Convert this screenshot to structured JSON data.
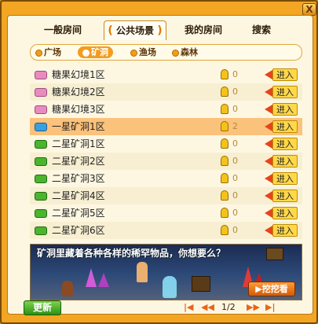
{
  "window": {
    "close_label": "X"
  },
  "main_tabs": [
    {
      "label": "一般房间"
    },
    {
      "label": "公共场景"
    },
    {
      "label": "我的房间"
    },
    {
      "label": "搜索"
    }
  ],
  "sub_tabs": [
    {
      "label": "广场"
    },
    {
      "label": "矿洞"
    },
    {
      "label": "渔场"
    },
    {
      "label": "森林"
    }
  ],
  "rooms": [
    {
      "name": "糖果幻境1区",
      "count": "0",
      "icon": "candy-icon",
      "action": "进入"
    },
    {
      "name": "糖果幻境2区",
      "count": "0",
      "icon": "candy-icon",
      "action": "进入"
    },
    {
      "name": "糖果幻境3区",
      "count": "0",
      "icon": "candy-icon",
      "action": "进入"
    },
    {
      "name": "一星矿洞1区",
      "count": "2",
      "icon": "blue-gem-icon",
      "action": "进入"
    },
    {
      "name": "二星矿洞1区",
      "count": "0",
      "icon": "green-ticket-icon",
      "action": "进入"
    },
    {
      "name": "二星矿洞2区",
      "count": "0",
      "icon": "green-ticket-icon",
      "action": "进入"
    },
    {
      "name": "二星矿洞3区",
      "count": "0",
      "icon": "green-ticket-icon",
      "action": "进入"
    },
    {
      "name": "二星矿洞4区",
      "count": "0",
      "icon": "green-ticket-icon",
      "action": "进入"
    },
    {
      "name": "二星矿洞5区",
      "count": "0",
      "icon": "green-ticket-icon",
      "action": "进入"
    },
    {
      "name": "二星矿洞6区",
      "count": "0",
      "icon": "green-ticket-icon",
      "action": "进入"
    }
  ],
  "banner": {
    "text": "矿洞里藏着各种各样的稀罕物品，你想要么？",
    "button_label": "挖挖看"
  },
  "footer": {
    "refresh_label": "更新",
    "page": "1/2"
  },
  "colors": {
    "accent": "#f39b1f",
    "frame": "#f2a623",
    "enter_button": "#ffd84a",
    "selected_row": "#fbc27c"
  }
}
